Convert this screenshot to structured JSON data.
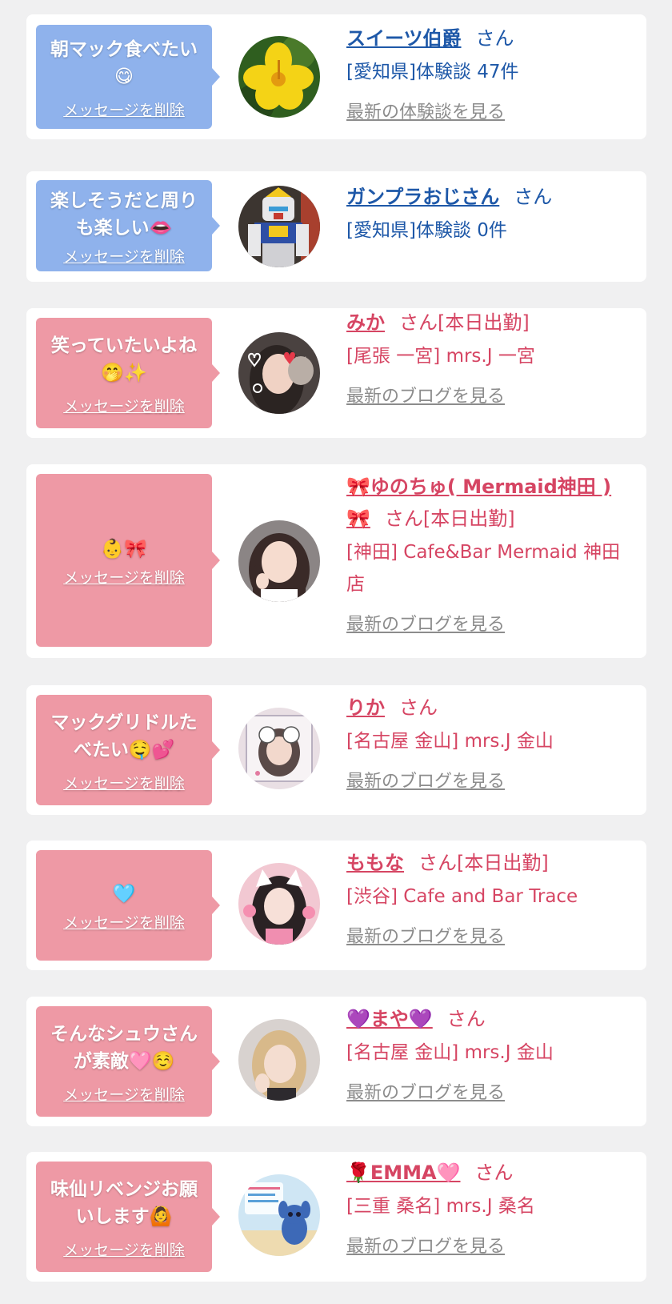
{
  "colors": {
    "blue_bubble": "#8fb2ec",
    "pink_bubble": "#ee99a5",
    "blue_text": "#1e58a8",
    "pink_text": "#d64563",
    "link_gray": "#8c8c8c"
  },
  "delete_label": "メッセージを削除",
  "cards": [
    {
      "bubble_color": "blue",
      "message": "朝マック食べたい😋",
      "name": "スイーツ伯爵",
      "suffix": "さん",
      "meta": "[愛知県]体験談 47件",
      "link": "最新の体験談を見る",
      "avatar": "yellow-flower-avatar"
    },
    {
      "bubble_color": "blue",
      "message": "楽しそうだと周りも楽しい👄",
      "name": "ガンプラおじさん",
      "suffix": "さん",
      "meta": "[愛知県]体験談 0件",
      "link": "",
      "avatar": "gundam-avatar"
    },
    {
      "bubble_color": "pink",
      "message": "笑っていたいよね🤭✨",
      "name": "みか",
      "suffix": "さん[本日出勤]",
      "meta": "[尾張 一宮] mrs.J 一宮",
      "link": "最新のブログを見る",
      "avatar": "mika-avatar"
    },
    {
      "bubble_color": "pink",
      "message": "👶🎀",
      "name": "🎀ゆのちゅ( Mermaid神田 ) 🎀",
      "suffix": "さん[本日出勤]",
      "meta": "[神田] Cafe&Bar Mermaid 神田店",
      "link": "最新のブログを見る",
      "avatar": "yunochu-avatar"
    },
    {
      "bubble_color": "pink",
      "message": "マックグリドルたべたい🤤💕",
      "name": "りか",
      "suffix": "さん",
      "meta": "[名古屋 金山] mrs.J 金山",
      "link": "最新のブログを見る",
      "avatar": "rika-avatar"
    },
    {
      "bubble_color": "pink",
      "message": "🩵",
      "name": "ももな",
      "suffix": "さん[本日出勤]",
      "meta": "[渋谷] Cafe and Bar Trace",
      "link": "最新のブログを見る",
      "avatar": "momona-avatar"
    },
    {
      "bubble_color": "pink",
      "message": "そんなシュウさんが素敵🩷☺️",
      "name": "💜まや💜",
      "suffix": "さん",
      "meta": "[名古屋 金山] mrs.J 金山",
      "link": "最新のブログを見る",
      "avatar": "maya-avatar"
    },
    {
      "bubble_color": "pink",
      "message": "味仙リベンジお願いします🙆",
      "name": "🌹EMMA🩷",
      "suffix": "さん",
      "meta": "[三重 桑名] mrs.J 桑名",
      "link": "最新のブログを見る",
      "avatar": "emma-avatar"
    }
  ]
}
